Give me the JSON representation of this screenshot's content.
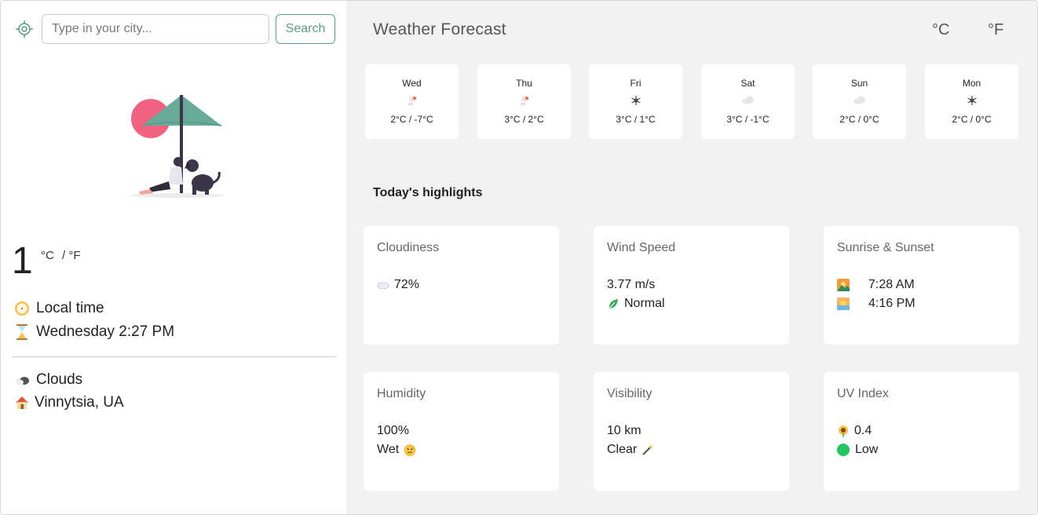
{
  "search": {
    "placeholder": "Type in your city...",
    "button_label": "Search"
  },
  "current": {
    "temperature": "1",
    "unit_c": "°C",
    "unit_sep": "/ °F",
    "local_time_label": "Local time",
    "datetime": "Wednesday 2:27 PM",
    "condition": "Clouds",
    "location": "Vinnytsia, UA"
  },
  "header": {
    "title": "Weather Forecast",
    "unit_c": "°C",
    "unit_f": "°F"
  },
  "forecast": [
    {
      "day": "Wed",
      "icon": "snow-rain-icon",
      "range": "2°C / -7°C"
    },
    {
      "day": "Thu",
      "icon": "snow-rain-icon",
      "range": "3°C / 2°C"
    },
    {
      "day": "Fri",
      "icon": "snowflake-icon",
      "range": "3°C / 1°C"
    },
    {
      "day": "Sat",
      "icon": "cloud-icon",
      "range": "3°C / -1°C"
    },
    {
      "day": "Sun",
      "icon": "cloud-icon",
      "range": "2°C / 0°C"
    },
    {
      "day": "Mon",
      "icon": "snowflake-icon",
      "range": "2°C / 0°C"
    }
  ],
  "highlights": {
    "title": "Today's highlights",
    "cloudiness": {
      "title": "Cloudiness",
      "value": "72%"
    },
    "wind": {
      "title": "Wind Speed",
      "value": "3.77 m/s",
      "status": "Normal"
    },
    "sun": {
      "title": "Sunrise & Sunset",
      "sunrise": "7:28 AM",
      "sunset": "4:16 PM"
    },
    "humidity": {
      "title": "Humidity",
      "value": "100%",
      "status": "Wet"
    },
    "visibility": {
      "title": "Visibility",
      "value": "10 km",
      "status": "Clear"
    },
    "uv": {
      "title": "UV Index",
      "value": "0.4",
      "status": "Low"
    }
  },
  "colors": {
    "accent": "#5a9e8b",
    "panel_bg": "#f2f2f2",
    "uv_low": "#22c55e",
    "sun_circle": "#f0627e"
  }
}
